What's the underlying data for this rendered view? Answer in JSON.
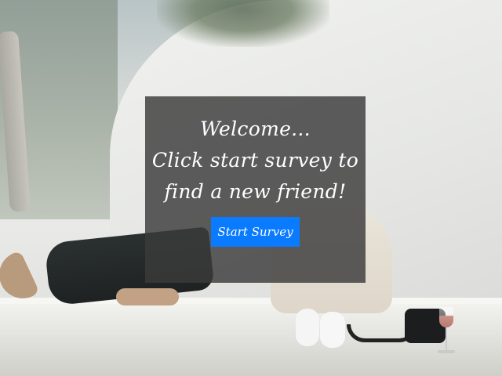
{
  "hero": {
    "welcome_text": "Welcome...\nClick start survey to\nfind a new friend!",
    "start_button_label": "Start Survey"
  },
  "colors": {
    "overlay": "#3a3a3a",
    "button": "#0a7bff",
    "text": "#ffffff"
  }
}
